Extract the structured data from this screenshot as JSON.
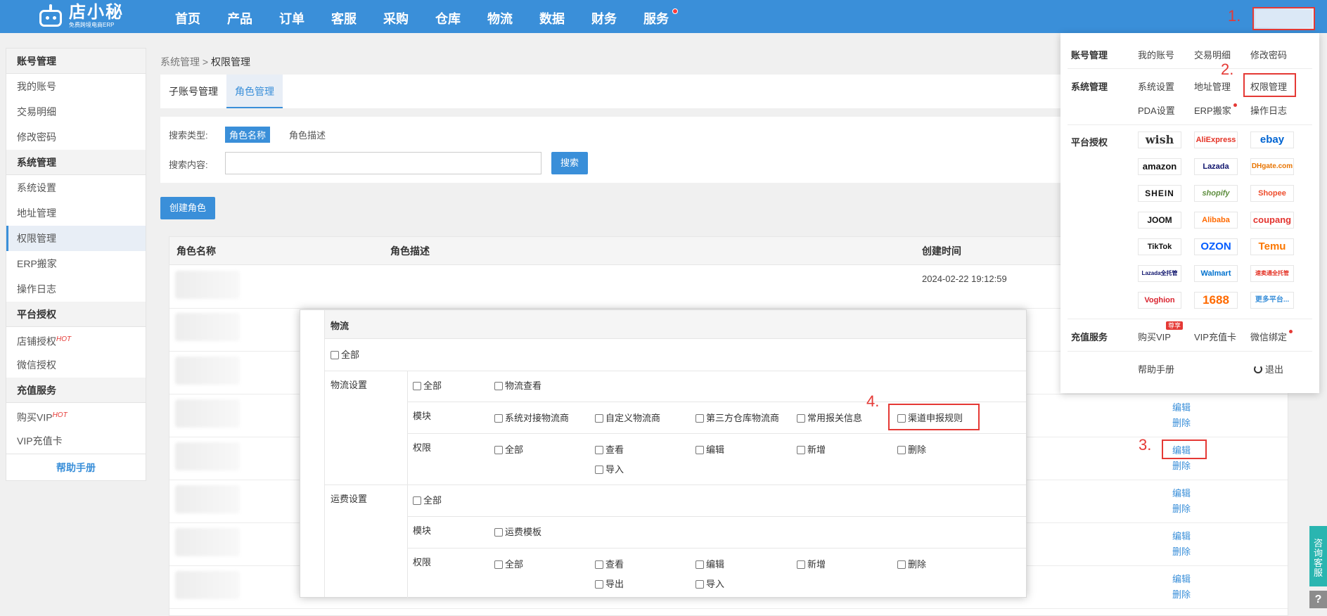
{
  "brand": {
    "name": "店小秘",
    "tagline": "免费跨境电商ERP"
  },
  "nav": [
    "首页",
    "产品",
    "订单",
    "客服",
    "采购",
    "仓库",
    "物流",
    "数据",
    "财务",
    "服务"
  ],
  "steps": {
    "s1": "1.",
    "s2": "2.",
    "s3": "3.",
    "s4": "4."
  },
  "sidebar": {
    "groups": [
      {
        "title": "账号管理",
        "items": [
          "我的账号",
          "交易明细",
          "修改密码"
        ]
      },
      {
        "title": "系统管理",
        "items": [
          "系统设置",
          "地址管理",
          "权限管理",
          "ERP搬家",
          "操作日志"
        ]
      },
      {
        "title": "平台授权",
        "items": [
          "店铺授权",
          "微信授权"
        ]
      },
      {
        "title": "充值服务",
        "items": [
          "购买VIP",
          "VIP充值卡"
        ]
      }
    ],
    "hot": "HOT",
    "help": "帮助手册"
  },
  "breadcrumb": {
    "parent": "系统管理",
    "sep": " > ",
    "current": "权限管理"
  },
  "tabs": [
    "子账号管理",
    "角色管理"
  ],
  "search": {
    "type_label": "搜索类型:",
    "opt1": "角色名称",
    "opt2": "角色描述",
    "content_label": "搜索内容:",
    "button": "搜索"
  },
  "create_button": "创建角色",
  "table": {
    "headers": {
      "name": "角色名称",
      "desc": "角色描述",
      "time": "创建时间"
    },
    "first_row_date": "2024-02-22 19:12:59",
    "edit": "编辑",
    "delete": "删除"
  },
  "dialog": {
    "title": "物流",
    "all": "全部",
    "section1": "物流设置",
    "section2": "运费设置",
    "module": "模块",
    "perm": "权限",
    "s1_top": [
      "全部",
      "物流查看"
    ],
    "s1_modules": [
      "系统对接物流商",
      "自定义物流商",
      "第三方仓库物流商",
      "常用报关信息",
      "渠道申报规则"
    ],
    "s1_perms": [
      "全部",
      "查看",
      "编辑",
      "新增",
      "删除",
      "导入"
    ],
    "s2_top": "全部",
    "s2_modules": [
      "运费模板"
    ],
    "s2_perms": [
      "全部",
      "查看",
      "编辑",
      "新增",
      "删除",
      "导出",
      "导入"
    ]
  },
  "dropdown": {
    "account": {
      "title": "账号管理",
      "links": [
        "我的账号",
        "交易明细",
        "修改密码"
      ]
    },
    "system": {
      "title": "系统管理",
      "links": [
        "系统设置",
        "地址管理",
        "权限管理",
        "PDA设置",
        "ERP搬家",
        "操作日志"
      ]
    },
    "platform": {
      "title": "平台授权",
      "logos": [
        "wish",
        "AliExpress",
        "ebay",
        "amazon",
        "Lazada",
        "DHgate.com",
        "SHEIN",
        "shopify",
        "Shopee",
        "JOOM",
        "Alibaba",
        "coupang",
        "TikTok",
        "OZON",
        "Temu",
        "Lazada全托管",
        "Walmart",
        "速卖通全托管",
        "Voghion",
        "1688",
        "更多平台..."
      ]
    },
    "recharge": {
      "title": "充值服务",
      "links": [
        "购买VIP",
        "VIP充值卡",
        "微信绑定"
      ],
      "badge": "尊享"
    },
    "help": "帮助手册",
    "logout": "退出"
  },
  "float": {
    "service": "咨询客服",
    "help": "?"
  },
  "colors": {
    "primary": "#3a8fd9",
    "highlight": "#e53935"
  }
}
